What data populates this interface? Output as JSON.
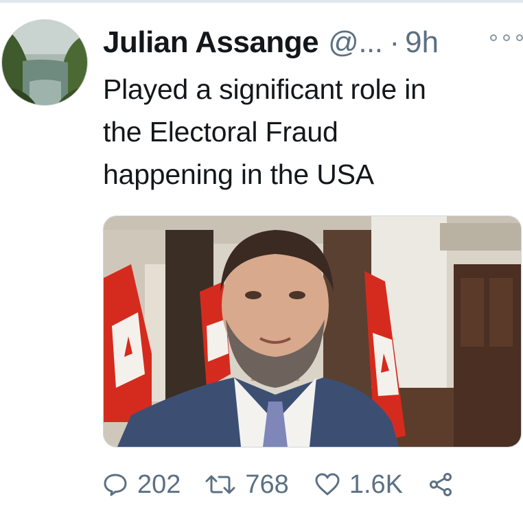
{
  "tweet": {
    "author_name": "Julian Assange",
    "author_handle": "@...",
    "separator": "·",
    "timestamp": "9h",
    "text_lines": [
      "Played a significant role in",
      "the Electoral Fraud",
      "happening in the USA"
    ],
    "avatar_icon": "landscape-avatar",
    "more_icon": "more-options-icon"
  },
  "actions": {
    "reply_count": "202",
    "retweet_count": "768",
    "like_count": "1.6K",
    "reply_icon": "reply-icon",
    "retweet_icon": "retweet-icon",
    "like_icon": "heart-icon",
    "share_icon": "share-icon"
  },
  "colors": {
    "text_primary": "#14171a",
    "text_secondary": "#5b7083",
    "divider": "#e1e8ed"
  }
}
